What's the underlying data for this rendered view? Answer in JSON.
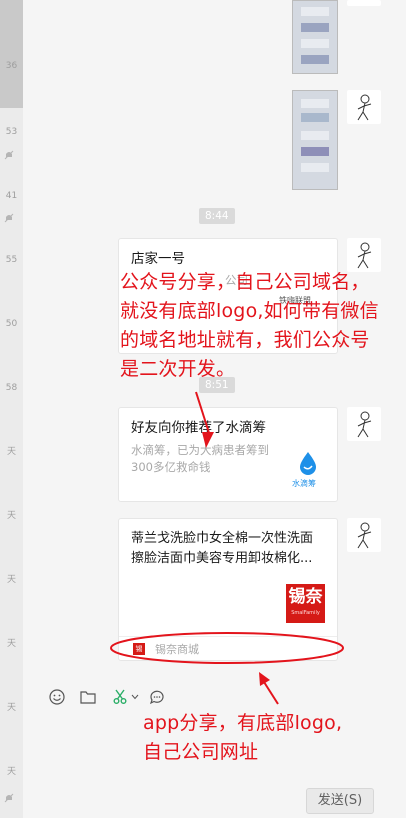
{
  "sidebar": {
    "items": [
      {
        "text": "36"
      },
      {
        "text": "53"
      },
      {
        "text": "41"
      },
      {
        "text": "55"
      },
      {
        "text": "50"
      },
      {
        "text": "58"
      },
      {
        "text": "天"
      },
      {
        "text": "天"
      },
      {
        "text": "天"
      },
      {
        "text": "天"
      },
      {
        "text": "天"
      },
      {
        "text": "天"
      },
      {
        "text": "天"
      }
    ]
  },
  "chat": {
    "times": [
      "8:44",
      "8:51"
    ],
    "card1": {
      "title": "店家一号",
      "desc_partial": "公司",
      "logo_partial": "铁嗨联盟"
    },
    "card2": {
      "title": "好友向你推荐了水滴筹",
      "desc": "水滴筹，已为大病患者筹到300多亿救命钱",
      "logo_caption": "水滴筹"
    },
    "card3": {
      "title": "蒂兰戈洗脸巾女全棉一次性洗面擦脸洁面巾美容专用卸妆棉化...",
      "logo_text": "锡奈",
      "logo_sub": "SmalFamily",
      "source": "锡奈商城"
    }
  },
  "annotations": {
    "top": "公众号分享，自己公司域名，就没有底部logo,如何带有微信的域名地址就有，我们公众号是二次开发。",
    "bottom_line1": "app分享，有底部logo,",
    "bottom_line2": "自己公司网址"
  },
  "input": {
    "send_label": "发送(S)"
  },
  "colors": {
    "annotation": "#e3141c",
    "bubble": "#ffffff",
    "background": "#f5f5f5",
    "scissors": "#2aae67"
  },
  "icons": [
    "emoji-icon",
    "folder-icon",
    "scissors-icon",
    "chat-history-icon"
  ]
}
